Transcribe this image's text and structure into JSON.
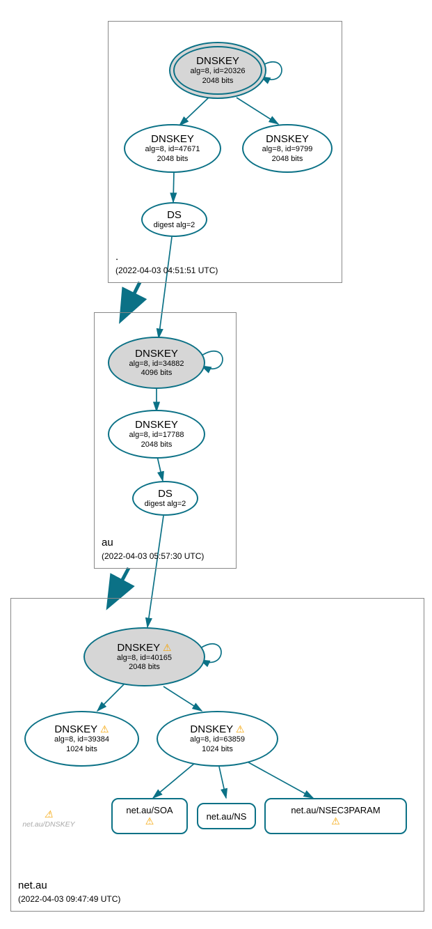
{
  "zones": {
    "root": {
      "name": ".",
      "timestamp": "(2022-04-03 04:51:51 UTC)"
    },
    "au": {
      "name": "au",
      "timestamp": "(2022-04-03 05:57:30 UTC)"
    },
    "netau": {
      "name": "net.au",
      "timestamp": "(2022-04-03 09:47:49 UTC)"
    }
  },
  "nodes": {
    "root_ksk": {
      "title": "DNSKEY",
      "line1": "alg=8, id=20326",
      "line2": "2048 bits"
    },
    "root_zsk": {
      "title": "DNSKEY",
      "line1": "alg=8, id=47671",
      "line2": "2048 bits"
    },
    "root_zsk2": {
      "title": "DNSKEY",
      "line1": "alg=8, id=9799",
      "line2": "2048 bits"
    },
    "root_ds": {
      "title": "DS",
      "line1": "digest alg=2"
    },
    "au_ksk": {
      "title": "DNSKEY",
      "line1": "alg=8, id=34882",
      "line2": "4096 bits"
    },
    "au_zsk": {
      "title": "DNSKEY",
      "line1": "alg=8, id=17788",
      "line2": "2048 bits"
    },
    "au_ds": {
      "title": "DS",
      "line1": "digest alg=2"
    },
    "netau_ksk": {
      "title": "DNSKEY",
      "line1": "alg=8, id=40165",
      "line2": "2048 bits"
    },
    "netau_zsk1": {
      "title": "DNSKEY",
      "line1": "alg=8, id=39384",
      "line2": "1024 bits"
    },
    "netau_zsk2": {
      "title": "DNSKEY",
      "line1": "alg=8, id=63859",
      "line2": "1024 bits"
    },
    "warn_note": {
      "text": "net.au/DNSKEY"
    }
  },
  "records": {
    "soa": {
      "label": "net.au/SOA"
    },
    "ns": {
      "label": "net.au/NS"
    },
    "nsec3": {
      "label": "net.au/NSEC3PARAM"
    }
  }
}
